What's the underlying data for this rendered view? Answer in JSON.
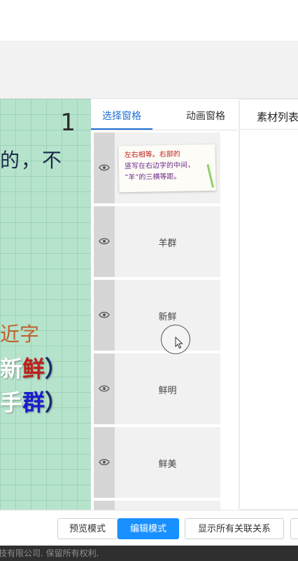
{
  "canvas": {
    "page_number": "1",
    "line1": "的，不",
    "line2": "近字",
    "line3": {
      "part1": "新",
      "part2": "鲜",
      "part3": "）"
    },
    "line4": {
      "part1": "手",
      "part2": "群",
      "part3": "）"
    }
  },
  "panel": {
    "tabs": {
      "select": "选择窗格",
      "animation": "动画窗格"
    },
    "note_image": {
      "line1": "左右相等。右部的",
      "line2": "竖写在右边字的中间，",
      "line3": "“羊”的三横等距。"
    },
    "items": [
      {
        "label": ""
      },
      {
        "label": "羊群"
      },
      {
        "label": "新鲜"
      },
      {
        "label": "鲜明"
      },
      {
        "label": "鲜美"
      },
      {
        "label": ""
      }
    ]
  },
  "assets": {
    "title": "素材列表"
  },
  "footer": {
    "preview": "预览模式",
    "edit": "编辑模式",
    "show_relations": "显示所有关联关系"
  },
  "copyright": "技有限公司. 保留所有权利.",
  "colors": {
    "accent": "#1890ff",
    "tab_active": "#1f6fd6",
    "canvas_bg": "#b6e3cc"
  },
  "icons": {
    "item_visibility": "eye-icon",
    "cursor": "mouse-cursor-icon"
  }
}
